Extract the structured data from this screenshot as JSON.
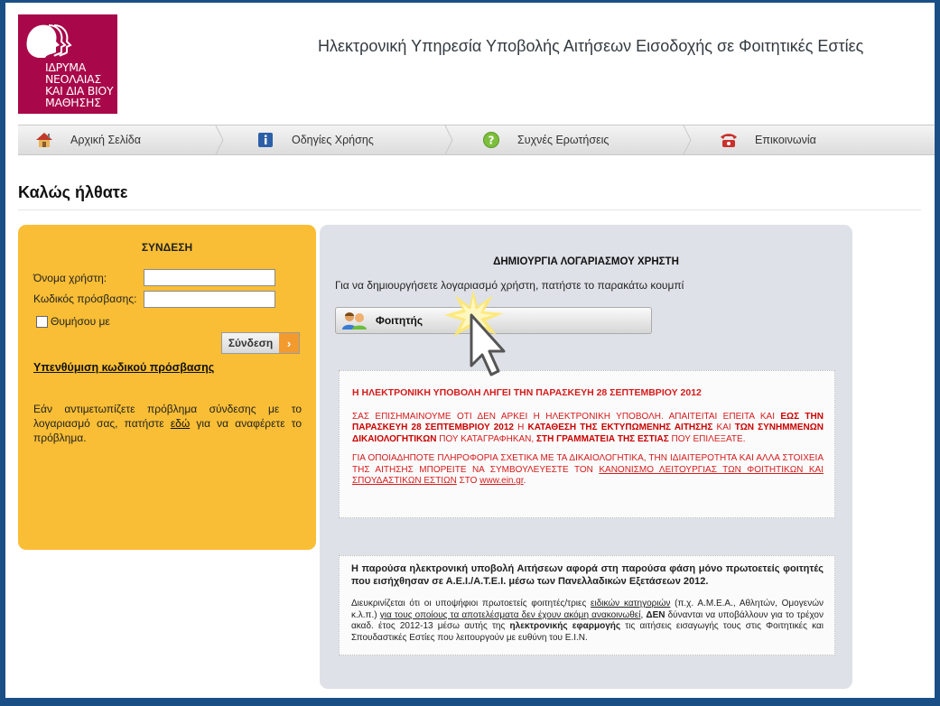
{
  "logo": {
    "lines": [
      "ΙΔΡΥΜΑ",
      "ΝΕΟΛΑΙΑΣ",
      "ΚΑΙ ΔΙΑ ΒΙΟΥ",
      "ΜΑΘΗΣΗΣ"
    ],
    "color": "#a8084a"
  },
  "header": {
    "title": "Ηλεκτρονική Υπηρεσία Υποβολής Αιτήσεων Εισοδοχής σε Φοιτητικές Εστίες"
  },
  "nav": {
    "items": [
      {
        "label": "Αρχική Σελίδα",
        "icon": "home-icon"
      },
      {
        "label": "Οδηγίες Χρήσης",
        "icon": "info-icon"
      },
      {
        "label": "Συχνές Ερωτήσεις",
        "icon": "question-icon"
      },
      {
        "label": "Επικοινωνία",
        "icon": "phone-icon"
      }
    ]
  },
  "page": {
    "welcome": "Καλώς ήλθατε"
  },
  "login": {
    "title": "ΣΥΝΔΕΣΗ",
    "username_label": "Όνομα χρήστη:",
    "username_value": "",
    "password_label": "Κωδικός πρόσβασης:",
    "password_value": "",
    "remember_label": "Θυμήσου με",
    "submit_label": "Σύνδεση",
    "reminder_link": "Υπενθύμιση κωδικού πρόσβασης",
    "help_before": "Εάν αντιμετωπίζετε πρόβλημα σύνδεσης με το λογαριασμό σας, πατήστε ",
    "help_link": "εδώ",
    "help_after": " για να αναφέρετε το πρόβλημα.",
    "box_color": "#f9be35"
  },
  "account": {
    "title": "ΔΗΜΙΟΥΡΓΙΑ ΛΟΓΑΡΙΑΣΜΟΥ ΧΡΗΣΤΗ",
    "description": "Για να δημιουργήσετε λογαριασμό χρήστη, πατήστε το παρακάτω κουμπί",
    "student_button": "Φοιτητής"
  },
  "notice_deadline": {
    "headline": "Η ΗΛΕΚΤΡΟΝΙΚΗ ΥΠΟΒΟΛΗ ΛΗΓΕΙ ΤΗΝ ΠΑΡΑΣΚΕΥΗ 28 ΣΕΠΤΕΜΒΡΙΟΥ 2012",
    "p1_a": "ΣΑΣ ΕΠΙΣΗΜΑΙΝΟΥΜΕ ΟΤΙ ΔΕΝ ΑΡΚΕΙ Η ΗΛΕΚΤΡΟΝΙΚΗ ΥΠΟΒΟΛΗ. ΑΠΑΙΤΕΙΤΑΙ ΕΠΕΙΤΑ ΚΑΙ ",
    "p1_b": "ΕΩΣ ΤΗΝ ΠΑΡΑΣΚΕΥΗ 28 ΣΕΠΤΕΜΒΡΙΟΥ 2012",
    "p1_c": " Η ",
    "p1_d": "ΚΑΤΑΘΕΣΗ ΤΗΣ ΕΚΤΥΠΩΜΕΝΗΣ ΑΙΤΗΣΗΣ",
    "p1_e": " ΚΑΙ ",
    "p1_f": "ΤΩΝ ΣΥΝΗΜΜΕΝΩΝ ΔΙΚΑΙΟΛΟΓΗΤΙΚΩΝ",
    "p1_g": " ΠΟΥ ΚΑΤΑΓΡΑΦΗΚΑΝ, ",
    "p1_h": "ΣΤΗ ΓΡΑΜΜΑΤΕΙΑ ΤΗΣ ΕΣΤΙΑΣ",
    "p1_i": " ΠΟΥ ΕΠΙΛΕΞΑΤΕ.",
    "p2_a": "ΓΙΑ ΟΠΟΙΑΔΗΠΟΤΕ ΠΛΗΡΟΦΟΡΙΑ ΣΧΕΤΙΚΑ ΜΕ ΤΑ ΔΙΚΑΙΟΛΟΓΗΤΙΚΑ, ΤΗΝ ΙΔΙΑΙΤΕΡΟΤΗΤΑ ΚΑΙ ΑΛΛΑ ΣΤΟΙΧΕΙΑ ΤΗΣ ΑΙΤΗΣΗΣ ΜΠΟΡΕΙΤΕ ΝΑ ΣΥΜΒΟΥΛΕΥΕΣΤΕ ΤΟΝ ",
    "p2_link": "ΚΑΝΟΝΙΣΜΟ ΛΕΙΤΟΥΡΓΙΑΣ ΤΩΝ ΦΟΙΤΗΤΙΚΩΝ ΚΑΙ ΣΠΟΥΔΑΣΤΙΚΩΝ ΕΣΤΙΩΝ",
    "p2_b": " ΣΤΟ ",
    "p2_url": "www.ein.gr",
    "p2_c": "."
  },
  "notice_info": {
    "headline": "Η παρούσα ηλεκτρονική υποβολή Αιτήσεων αφορά στη παρούσα φάση μόνο πρωτοετείς φοιτητές που εισήχθησαν σε Α.Ε.Ι./Α.Τ.Ε.Ι. μέσω των Πανελλαδικών Εξετάσεων 2012.",
    "p_a": "Διευκρινίζεται ότι οι υποψήφιοι πρωτοετείς φοιτητές/τριες ",
    "p_link1": "ειδικών κατηγοριών",
    "p_b": " (π.χ. Α.Μ.Ε.Α., Αθλητών, Ομογενών κ.λ.π.) ",
    "p_link2": "για τους οποίους τα αποτελέσματα δεν έχουν ακόμη ανακοινωθεί",
    "p_c": ", ",
    "p_bold1": "ΔΕΝ",
    "p_d": " δύνανται να υποβάλλουν για το τρέχον ακαδ. έτος 2012-13 μέσω αυτής της ",
    "p_bold2": "ηλεκτρονικής εφαρμογής",
    "p_e": " τις αιτήσεις εισαγωγής τους στις Φοιτητικές και Σπουδαστικές Εστίες που λειτουργούν με ευθύνη του Ε.Ι.Ν."
  }
}
